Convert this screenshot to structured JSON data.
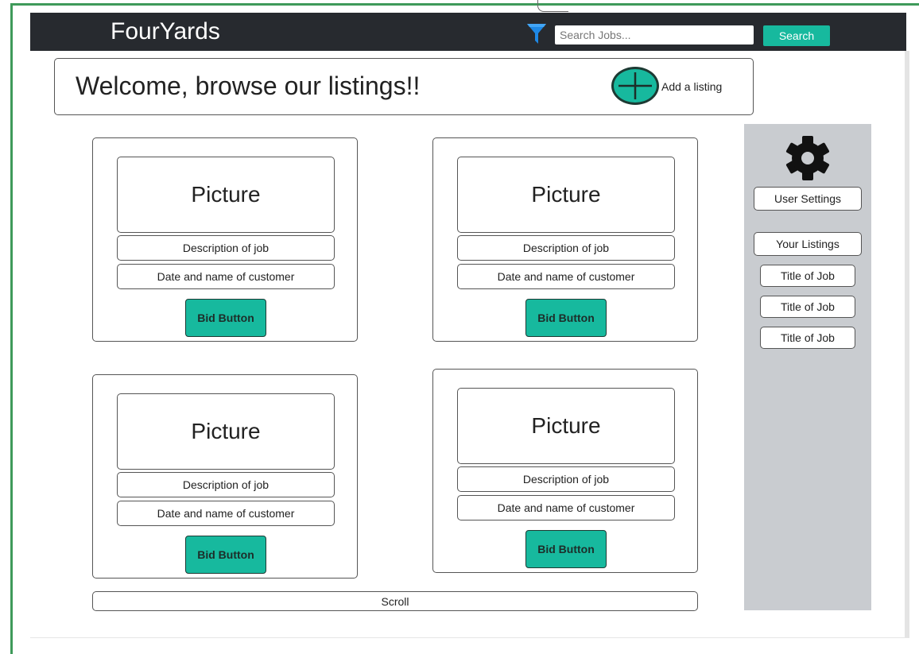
{
  "header": {
    "brand": "FourYards",
    "filter_icon": "filter-funnel-icon",
    "search_placeholder": "Search Jobs...",
    "search_label": "Search",
    "accent_color": "#17b99e",
    "bar_color": "#272a2f"
  },
  "welcome": {
    "title": "Welcome, browse our listings!!",
    "add_icon": "plus-circle-icon",
    "add_label": "Add a listing"
  },
  "listings": [
    {
      "picture": "Picture",
      "description": "Description of job",
      "date_customer": "Date and name of customer",
      "bid_label": "Bid Button"
    },
    {
      "picture": "Picture",
      "description": "Description of job",
      "date_customer": "Date and name of customer",
      "bid_label": "Bid Button"
    },
    {
      "picture": "Picture",
      "description": "Description of job",
      "date_customer": "Date and name of customer",
      "bid_label": "Bid Button"
    },
    {
      "picture": "Picture",
      "description": "Description of job",
      "date_customer": "Date and name of customer",
      "bid_label": "Bid Button"
    }
  ],
  "scroll_label": "Scroll",
  "sidebar": {
    "settings_icon": "gear-icon",
    "user_settings": "User Settings",
    "your_listings": "Your Listings",
    "jobs": [
      "Title of Job",
      "Title of Job",
      "Title of Job"
    ]
  }
}
